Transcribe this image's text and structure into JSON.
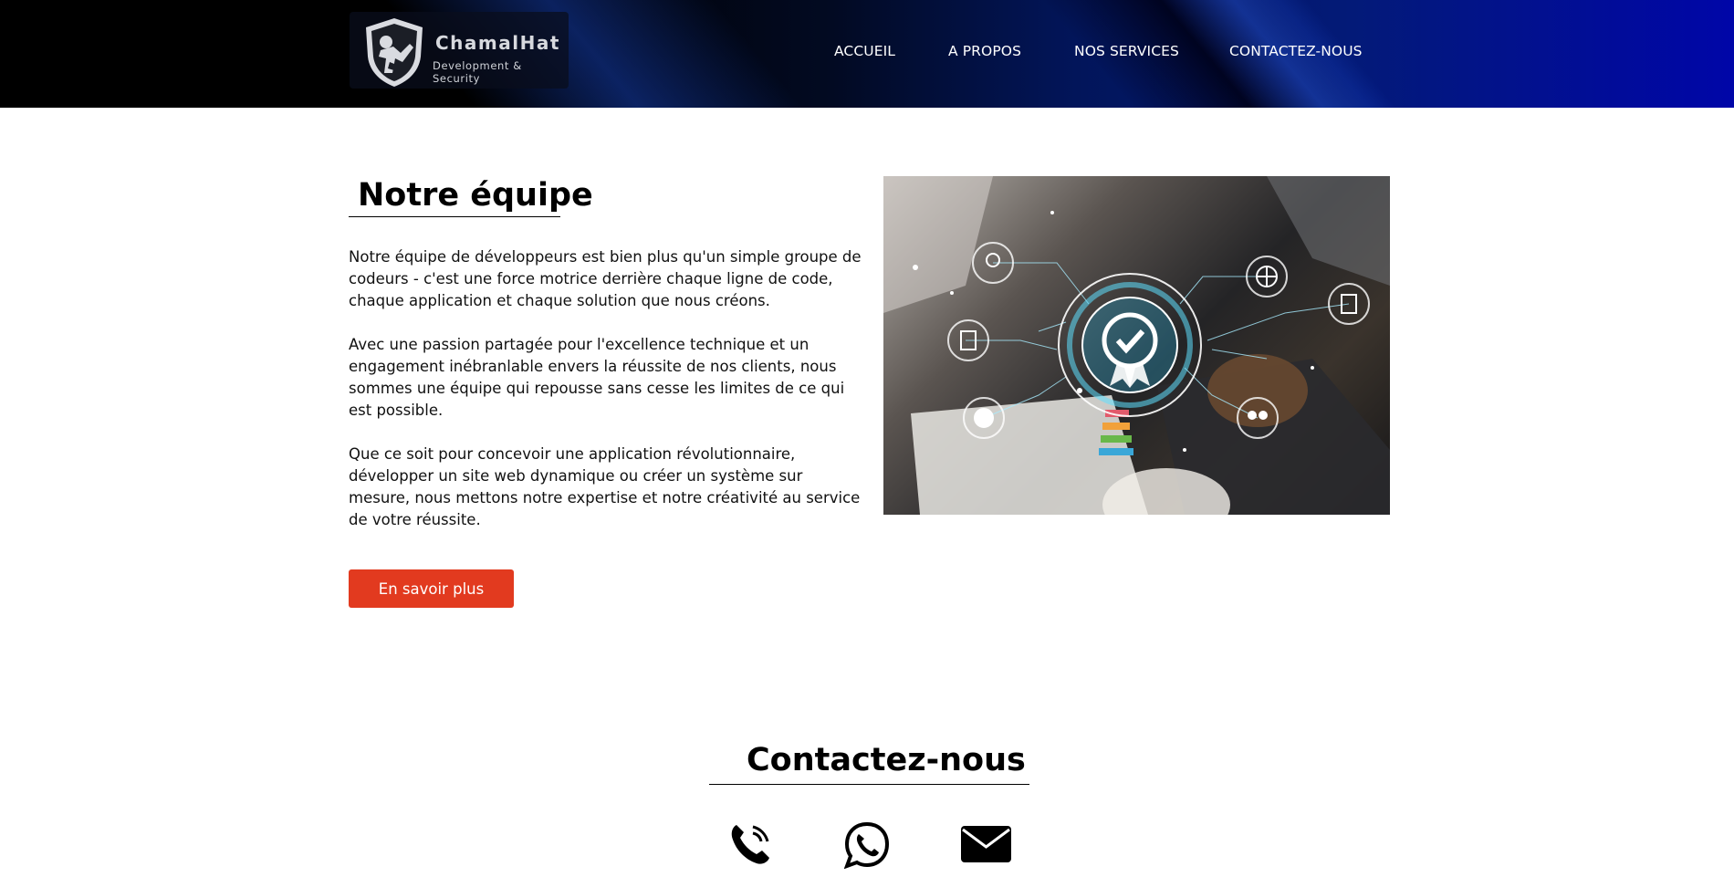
{
  "brand": {
    "name": "ChamalHat",
    "tagline": "Development & Security",
    "logo_icon": "shield-hacker-icon"
  },
  "nav": {
    "items": [
      {
        "label": "ACCUEIL"
      },
      {
        "label": "A PROPOS"
      },
      {
        "label": "NOS SERVICES"
      },
      {
        "label": "CONTACTEZ-NOUS"
      }
    ]
  },
  "team": {
    "title": "Notre équipe",
    "paragraphs": [
      "Notre équipe de développeurs est bien plus qu'un simple groupe de codeurs - c'est une force motrice derrière chaque ligne de code, chaque application et chaque solution que nous créons.",
      "Avec une passion partagée pour l'excellence technique et un engagement inébranlable envers la réussite de nos clients, nous sommes une équipe qui repousse sans cesse les limites de ce qui est possible.",
      "Que ce soit pour concevoir une application révolutionnaire, développer un site web dynamique ou créer un système sur mesure, nous mettons notre expertise et notre créativité au service de votre réussite."
    ],
    "cta_label": "En savoir plus",
    "image_icons": [
      "award-icon",
      "globe-icon",
      "document-icon",
      "document-icon",
      "earth-icon",
      "team-icon",
      "certified-check-icon"
    ]
  },
  "contact": {
    "title": "Contactez-nous",
    "icons": [
      "phone-icon",
      "whatsapp-icon",
      "email-icon"
    ]
  },
  "colors": {
    "accent": "#e23a1f",
    "header_dark": "#000000",
    "header_blue": "#0006a8"
  }
}
